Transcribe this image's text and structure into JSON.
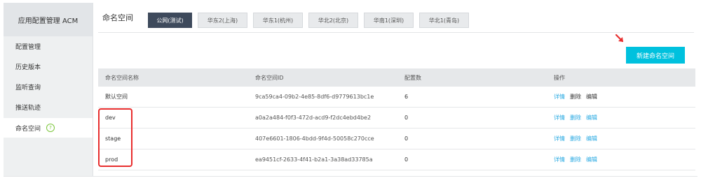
{
  "sidebar": {
    "title": "应用配置管理 ACM",
    "items": [
      {
        "label": "配置管理"
      },
      {
        "label": "历史版本"
      },
      {
        "label": "监听查询"
      },
      {
        "label": "推送轨迹"
      },
      {
        "label": "命名空间",
        "help_icon": "?"
      }
    ]
  },
  "header": {
    "title": "命名空间",
    "tabs": [
      {
        "label": "公网(测试)",
        "active": true
      },
      {
        "label": "华东2(上海)"
      },
      {
        "label": "华东1(杭州)"
      },
      {
        "label": "华北2(北京)"
      },
      {
        "label": "华南1(深圳)"
      },
      {
        "label": "华北1(青岛)"
      }
    ]
  },
  "new_namespace_button": "新建命名空间",
  "table": {
    "columns": [
      "命名空间名称",
      "命名空间ID",
      "配置数",
      "操作"
    ],
    "rows": [
      {
        "name": "默认空间",
        "id": "9ca59ca4-09b2-4e85-8df6-d9779613bc1e",
        "count": "6",
        "actions": [
          "详情",
          "删除",
          "编辑"
        ]
      },
      {
        "name": "dev",
        "id": "a0a2a484-f0f3-472d-acd9-f2dc4ebd4be2",
        "count": "0",
        "actions": [
          "详情",
          "删除",
          "编辑"
        ]
      },
      {
        "name": "stage",
        "id": "407e6601-1806-4bdd-9f4d-50058c270cce",
        "count": "0",
        "actions": [
          "详情",
          "删除",
          "编辑"
        ]
      },
      {
        "name": "prod",
        "id": "ea9451cf-2633-4f41-b2a1-3a38ad33785a",
        "count": "0",
        "actions": [
          "详情",
          "删除",
          "编辑"
        ]
      }
    ]
  },
  "colors": {
    "accent": "#00c1de",
    "link": "#26a8e2",
    "active_tab": "#3e4a5c",
    "annotation": "#e82e2e"
  },
  "icons": [
    "help-icon",
    "red-arrow-icon"
  ]
}
